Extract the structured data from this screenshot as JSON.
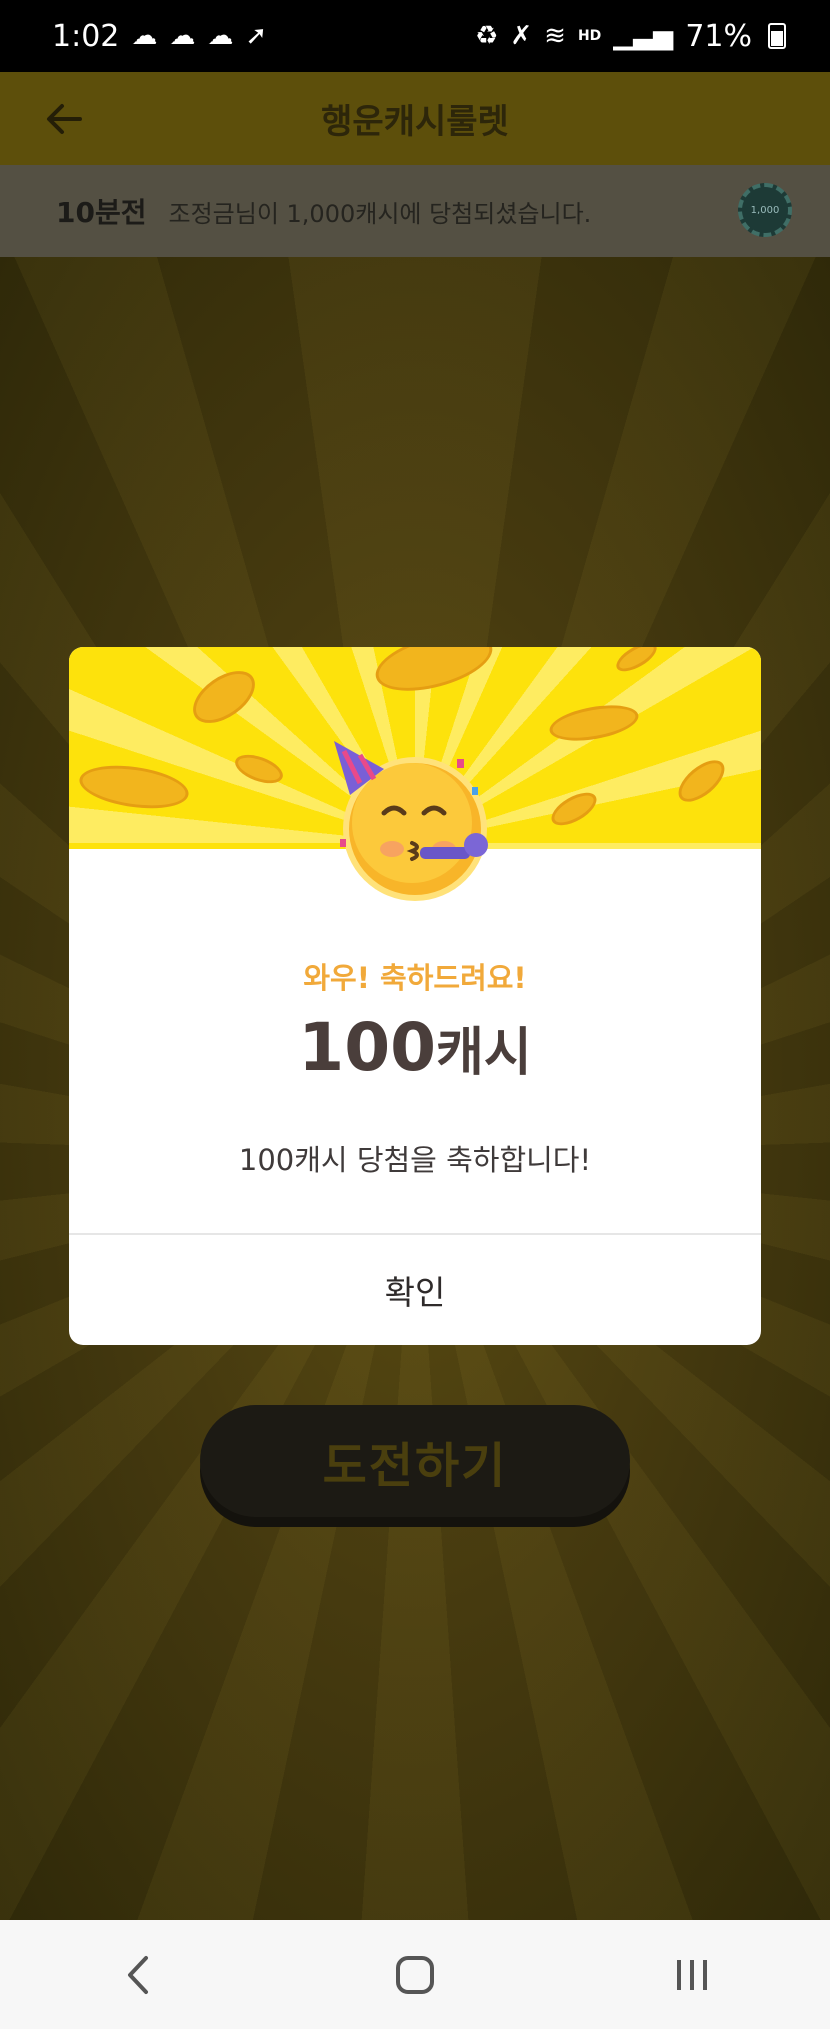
{
  "status": {
    "time": "1:02",
    "battery": "71%",
    "icons": [
      "chat-bubble-icon",
      "won-icon",
      "chat-bubble-icon",
      "shoe-icon",
      "recycle-icon",
      "mute-icon",
      "wifi-icon",
      "hd-voice-icon",
      "signal-icon",
      "battery-icon"
    ],
    "hd_voice": "HD"
  },
  "header": {
    "title": "행운캐시룰렛"
  },
  "ticker": {
    "time_ago": "10분전",
    "message": "조정금님이 1,000캐시에 당첨되셨습니다.",
    "chip_label": "1,000"
  },
  "modal": {
    "wow": "와우! 축하드려요!",
    "amount_number": "100",
    "amount_unit": "캐시",
    "congrats": "100캐시 당첨을 축하합니다!",
    "confirm_label": "확인"
  },
  "challenge": {
    "label": "도전하기"
  },
  "colors": {
    "banner": "#fde20c",
    "wow_text": "#f1a93a",
    "dim_overlay": "#3a3110"
  }
}
